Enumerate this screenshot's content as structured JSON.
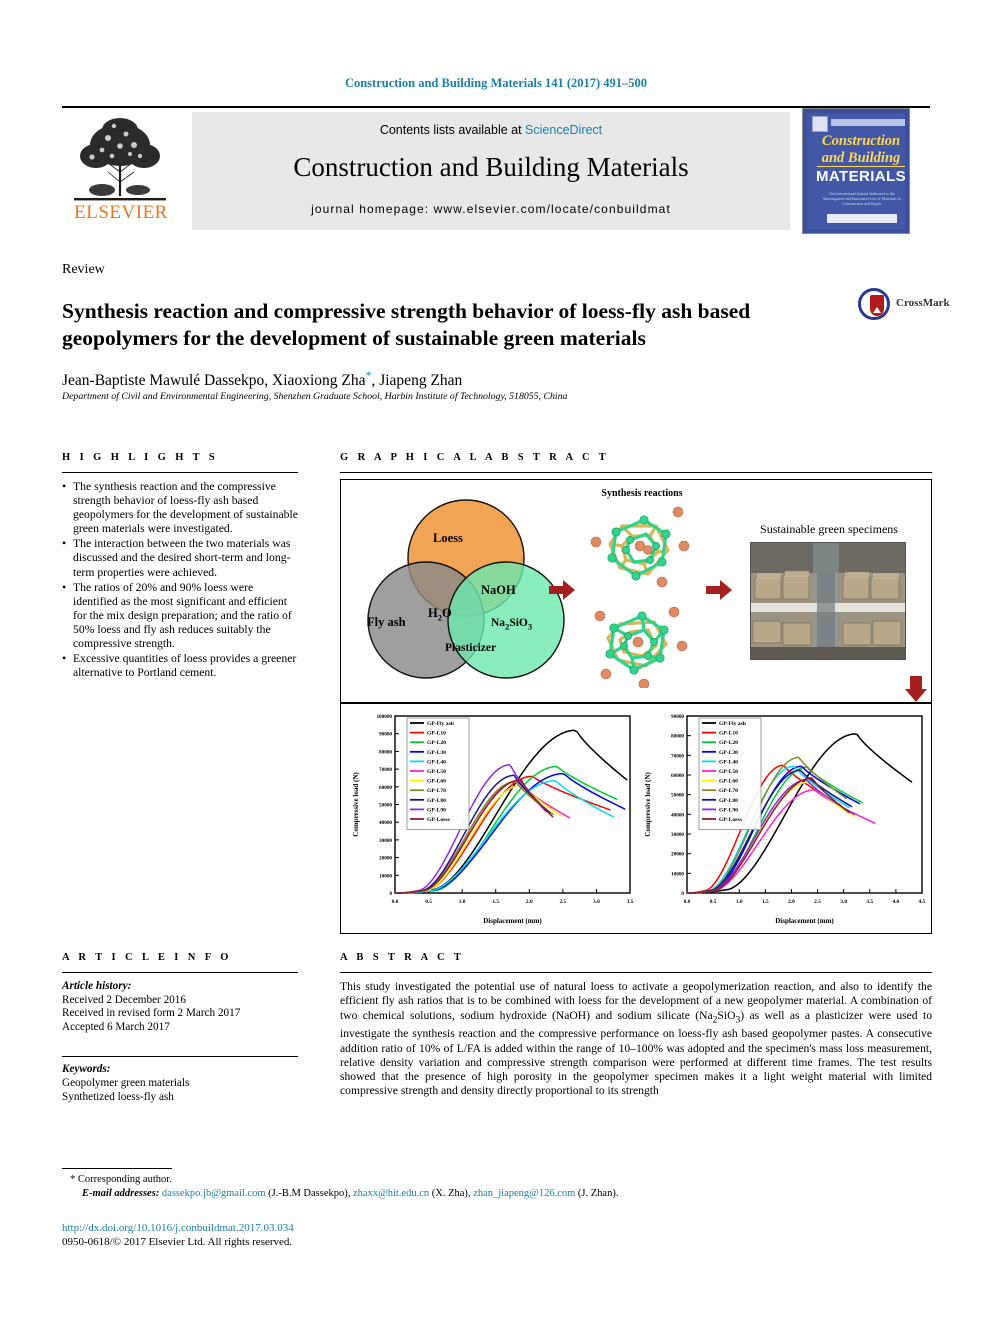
{
  "running_head": "Construction and Building Materials 141 (2017) 491–500",
  "masthead": {
    "publisher": "ELSEVIER",
    "contents_prefix": "Contents lists available at ",
    "sciencedirect": "ScienceDirect",
    "journal_title": "Construction and Building Materials",
    "homepage": "journal homepage: www.elsevier.com/locate/conbuildmat",
    "cover": {
      "line1": "Construction",
      "line2": "and Building",
      "line3": "MATERIALS"
    }
  },
  "article": {
    "type": "Review",
    "title": "Synthesis reaction and compressive strength behavior of loess-fly ash based geopolymers for the development of sustainable green materials",
    "authors": "Jean-Baptiste Mawulé Dassekpo, Xiaoxiong Zha",
    "authors_tail": ", Jiapeng Zhan",
    "corresponding_marker": "*",
    "affiliation": "Department of Civil and Environmental Engineering, Shenzhen Graduate School, Harbin Institute of Technology, 518055, China",
    "crossmark_label": "CrossMark"
  },
  "highlights": {
    "heading": "H I G H L I G H T S",
    "items": [
      "The synthesis reaction and the compressive strength behavior of loess-fly ash based geopolymers for the development of sustainable green materials were investigated.",
      "The interaction between the two materials was discussed and the desired short-term and long-term properties were achieved.",
      "The ratios of 20% and 90% loess were identified as the most significant and efficient for the mix design preparation; and the ratio of 50% loess and fly ash reduces suitably the compressive strength.",
      "Excessive quantities of loess provides a greener alternative to Portland cement."
    ]
  },
  "graphical_abstract": {
    "heading": "G R A P H I C A L   A B S T R A C T",
    "venn": {
      "loess": "Loess",
      "fly_ash": "Fly ash",
      "naoh": "NaOH",
      "h2o": "H",
      "h2o_sub": "2",
      "h2o_tail": "O",
      "na2sio3_a": "Na",
      "na2sio3_sub1": "2",
      "na2sio3_b": "SiO",
      "na2sio3_sub2": "3",
      "plasticizer": "Plasticizer",
      "colors": {
        "loess": "#F0A04B",
        "fly_ash": "#8A8A8A",
        "silicate": "#6BE8AE"
      }
    },
    "synthesis_title": "Synthesis reactions",
    "specimens_title": "Sustainable green specimens",
    "arrow_color": "#A71E1E"
  },
  "chart_data": [
    {
      "type": "line",
      "title": "",
      "xlabel": "Displacement (mm)",
      "ylabel": "Compressive load (N)",
      "xlim": [
        0.0,
        3.5
      ],
      "ylim": [
        0,
        100000
      ],
      "xticks": [
        "0.0",
        "0.5",
        "1.0",
        "1.5",
        "2.0",
        "2.5",
        "3.0",
        "3.5"
      ],
      "yticks": [
        "0",
        "10000",
        "20000",
        "30000",
        "40000",
        "50000",
        "60000",
        "70000",
        "80000",
        "90000",
        "100000"
      ],
      "grid": false,
      "legend_position": "top-left",
      "series": [
        {
          "name": "GP-Fly ash",
          "color": "#000000",
          "peak_x": 2.7,
          "peak_y": 92000,
          "end_x": 3.45,
          "end_y": 64000,
          "onset": 0.55
        },
        {
          "name": "GP-L10",
          "color": "#FF0000",
          "peak_x": 2.05,
          "peak_y": 66000,
          "end_x": 3.2,
          "end_y": 47000,
          "onset": 0.45
        },
        {
          "name": "GP-L20",
          "color": "#00CC33",
          "peak_x": 2.42,
          "peak_y": 71500,
          "end_x": 3.3,
          "end_y": 53000,
          "onset": 0.6
        },
        {
          "name": "GP-L30",
          "color": "#0000EE",
          "peak_x": 2.52,
          "peak_y": 67500,
          "end_x": 3.42,
          "end_y": 47500,
          "onset": 0.55
        },
        {
          "name": "GP-L40",
          "color": "#00DDEE",
          "peak_x": 2.4,
          "peak_y": 63500,
          "end_x": 3.25,
          "end_y": 43000,
          "onset": 0.52
        },
        {
          "name": "GP-L50",
          "color": "#FF22CC",
          "peak_x": 1.82,
          "peak_y": 63000,
          "end_x": 2.6,
          "end_y": 42500,
          "onset": 0.4
        },
        {
          "name": "GP-L60",
          "color": "#FFEE00",
          "peak_x": 1.9,
          "peak_y": 61000,
          "end_x": 2.48,
          "end_y": 43500,
          "onset": 0.45
        },
        {
          "name": "GP-L70",
          "color": "#8A8A2A",
          "peak_x": 1.8,
          "peak_y": 63000,
          "end_x": 2.35,
          "end_y": 44500,
          "onset": 0.42
        },
        {
          "name": "GP-L80",
          "color": "#17178C",
          "peak_x": 1.78,
          "peak_y": 66500,
          "end_x": 2.3,
          "end_y": 45500,
          "onset": 0.4
        },
        {
          "name": "GP-L90",
          "color": "#8A2BE2",
          "peak_x": 1.72,
          "peak_y": 72500,
          "end_x": 2.25,
          "end_y": 46000,
          "onset": 0.35
        },
        {
          "name": "GP-Loess",
          "color": "#8B2020",
          "peak_x": 1.88,
          "peak_y": 64000,
          "end_x": 2.35,
          "end_y": 43000,
          "onset": 0.42
        }
      ]
    },
    {
      "type": "line",
      "title": "",
      "xlabel": "Displacement (mm)",
      "ylabel": "Compressive load (N)",
      "xlim": [
        0.0,
        4.5
      ],
      "ylim": [
        0,
        90000
      ],
      "xticks": [
        "0.0",
        "0.5",
        "1.0",
        "1.5",
        "2.0",
        "2.5",
        "3.0",
        "3.5",
        "4.0",
        "4.5"
      ],
      "yticks": [
        "0",
        "10000",
        "20000",
        "30000",
        "40000",
        "50000",
        "60000",
        "70000",
        "80000",
        "90000"
      ],
      "grid": false,
      "legend_position": "top-left",
      "series": [
        {
          "name": "GP-Fly ash",
          "color": "#000000",
          "peak_x": 3.25,
          "peak_y": 81000,
          "end_x": 4.3,
          "end_y": 56500,
          "onset": 0.75
        },
        {
          "name": "GP-L10",
          "color": "#FF0000",
          "peak_x": 1.85,
          "peak_y": 65000,
          "end_x": 2.95,
          "end_y": 44500,
          "onset": 0.35
        },
        {
          "name": "GP-L20",
          "color": "#00CC33",
          "peak_x": 2.3,
          "peak_y": 64000,
          "end_x": 3.35,
          "end_y": 46000,
          "onset": 0.55
        },
        {
          "name": "GP-L30",
          "color": "#0000EE",
          "peak_x": 2.2,
          "peak_y": 64500,
          "end_x": 3.3,
          "end_y": 45500,
          "onset": 0.5
        },
        {
          "name": "GP-L40",
          "color": "#00DDEE",
          "peak_x": 2.05,
          "peak_y": 64500,
          "end_x": 3.1,
          "end_y": 43500,
          "onset": 0.42
        },
        {
          "name": "GP-L50",
          "color": "#FF22CC",
          "peak_x": 2.45,
          "peak_y": 52500,
          "end_x": 3.6,
          "end_y": 35500,
          "onset": 0.5
        },
        {
          "name": "GP-L60",
          "color": "#FFEE00",
          "peak_x": 2.35,
          "peak_y": 56500,
          "end_x": 3.2,
          "end_y": 39000,
          "onset": 0.48
        },
        {
          "name": "GP-L70",
          "color": "#8A8A2A",
          "peak_x": 2.15,
          "peak_y": 69000,
          "end_x": 3.05,
          "end_y": 48000,
          "onset": 0.45
        },
        {
          "name": "GP-L80",
          "color": "#17178C",
          "peak_x": 2.18,
          "peak_y": 62500,
          "end_x": 3.15,
          "end_y": 44000,
          "onset": 0.45
        },
        {
          "name": "GP-L90",
          "color": "#8A2BE2",
          "peak_x": 2.3,
          "peak_y": 57500,
          "end_x": 3.2,
          "end_y": 40000,
          "onset": 0.48
        },
        {
          "name": "GP-Loess",
          "color": "#8B2020",
          "peak_x": 2.4,
          "peak_y": 58500,
          "end_x": 3.1,
          "end_y": 41000,
          "onset": 0.5
        }
      ]
    }
  ],
  "article_info": {
    "heading": "A R T I C L E   I N F O",
    "history_label": "Article history:",
    "history": [
      "Received 2 December 2016",
      "Received in revised form 2 March 2017",
      "Accepted 6 March 2017"
    ],
    "keywords_label": "Keywords:",
    "keywords": [
      "Geopolymer green materials",
      "Synthetized loess-fly ash"
    ]
  },
  "abstract": {
    "heading": "A B S T R A C T",
    "text": "This study investigated the potential use of natural loess to activate a geopolymerization reaction, and also to identify the efficient fly ash ratios that is to be combined with loess for the development of a new geopolymer material. A combination of two chemical solutions, sodium hydroxide (NaOH) and sodium silicate (Na2SiO3) as well as a plasticizer were used to investigate the synthesis reaction and the compressive performance on loess-fly ash based geopolymer pastes. A consecutive addition ratio of 10% of L/FA is added within the range of 10–100% was adopted and the specimen's mass loss measurement, relative density variation and compressive strength comparison were performed at different time frames. The test results showed that the presence of high porosity in the geopolymer specimen makes it a light weight material with limited compressive strength and density directly proportional to its strength"
  },
  "footnotes": {
    "corresponding": "Corresponding author.",
    "corresponding_marker": "*",
    "email_label": "E-mail addresses:",
    "emails": [
      {
        "address": "dassekpo.jb@gmail.com",
        "owner": "(J.-B.M Dassekpo),"
      },
      {
        "address": "zhaxx@hit.edu.cn",
        "owner": "(X. Zha),"
      },
      {
        "address": "zhan_jiapeng@126.com",
        "owner": "(J. Zhan)."
      }
    ],
    "doi": "http://dx.doi.org/10.1016/j.conbuildmat.2017.03.034",
    "copyright": "0950-0618/© 2017 Elsevier Ltd. All rights reserved."
  }
}
